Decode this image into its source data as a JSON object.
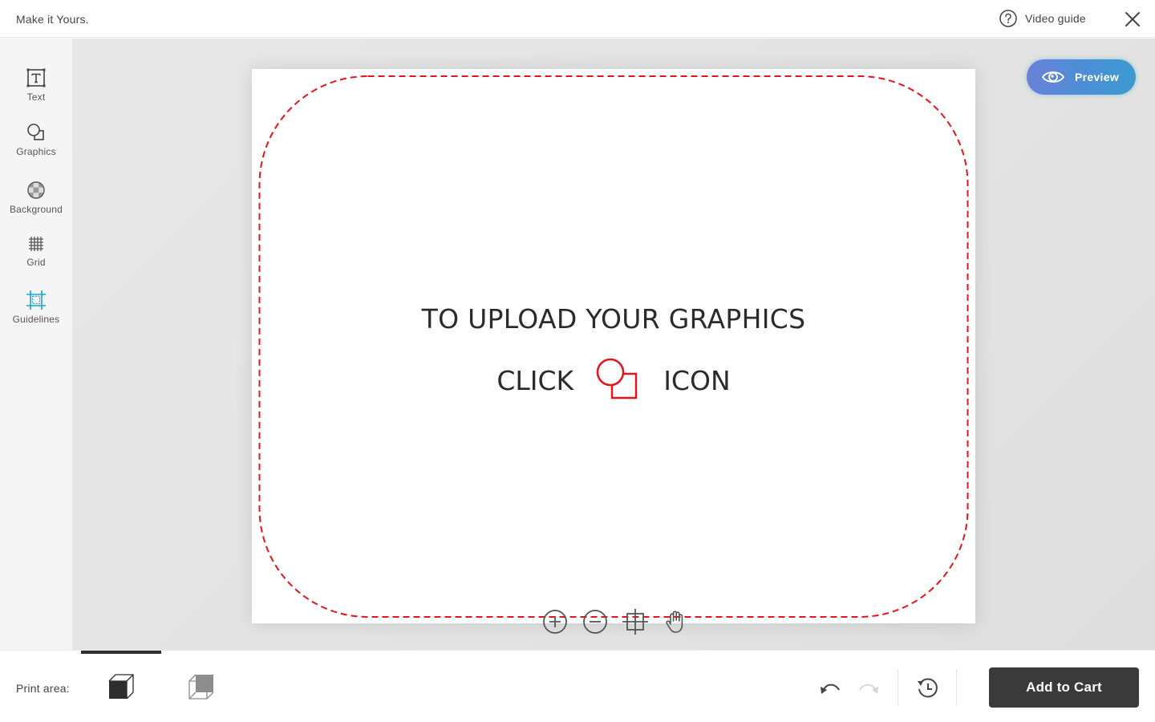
{
  "header": {
    "app_title": "Make it Yours.",
    "video_guide_label": "Video guide",
    "icons": {
      "help": "question-circle-icon",
      "close": "close-icon"
    }
  },
  "sidebar": {
    "items": [
      {
        "label": "Text",
        "icon": "text-box-icon",
        "active": false
      },
      {
        "label": "Graphics",
        "icon": "shapes-icon",
        "active": false
      },
      {
        "label": "Background",
        "icon": "checker-circle-icon",
        "active": false
      },
      {
        "label": "Grid",
        "icon": "grid-icon",
        "active": false
      },
      {
        "label": "Guidelines",
        "icon": "guidelines-icon",
        "active": true
      }
    ],
    "active_color": "#1aa3dc"
  },
  "canvas": {
    "hint_line1": "TO UPLOAD YOUR GRAPHICS",
    "hint_click": "CLICK",
    "hint_icon": "ICON",
    "hint_icon_name": "shapes-icon",
    "safe_area_color": "#e8141b"
  },
  "preview": {
    "label": "Preview",
    "icon": "eye-icon"
  },
  "zoom_tools": [
    {
      "name": "zoom-in",
      "icon": "zoom-in-icon"
    },
    {
      "name": "zoom-out",
      "icon": "zoom-out-icon"
    },
    {
      "name": "fit",
      "icon": "crosshair-frame-icon"
    },
    {
      "name": "pan",
      "icon": "hand-icon"
    }
  ],
  "footer": {
    "print_area_label": "Print area:",
    "print_options": [
      {
        "name": "front",
        "icon": "cube-front-icon",
        "selected": true
      },
      {
        "name": "back",
        "icon": "cube-back-icon",
        "selected": false
      }
    ],
    "undo_enabled": true,
    "redo_enabled": false,
    "add_to_cart_label": "Add to Cart"
  }
}
